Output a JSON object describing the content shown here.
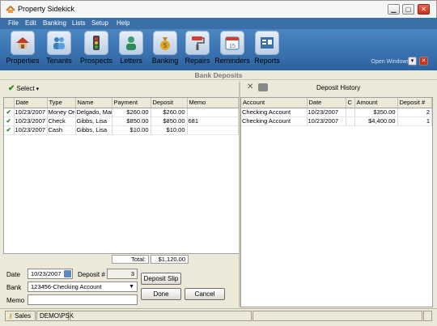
{
  "window": {
    "title": "Property Sidekick",
    "controls": [
      "minimize",
      "maximize",
      "close"
    ]
  },
  "menu": [
    "File",
    "Edit",
    "Banking",
    "Lists",
    "Setup",
    "Help"
  ],
  "toolbar": {
    "items": [
      {
        "label": "Properties",
        "icon": "house-icon"
      },
      {
        "label": "Tenants",
        "icon": "people-icon"
      },
      {
        "label": "Prospects",
        "icon": "traffic-light-icon"
      },
      {
        "label": "Letters",
        "icon": "person-letter-icon"
      },
      {
        "label": "Banking",
        "icon": "money-bag-icon"
      },
      {
        "label": "Repairs",
        "icon": "paint-roller-icon"
      },
      {
        "label": "Reminders",
        "icon": "calendar-icon"
      },
      {
        "label": "Reports",
        "icon": "report-icon"
      }
    ],
    "open_windows": "Open Windows"
  },
  "section_title": "Bank Deposits",
  "deposit_list": {
    "select_label": "Select",
    "columns": [
      "",
      "Date",
      "Type",
      "Name",
      "Payment",
      "Deposit",
      "Memo"
    ],
    "rows": [
      {
        "checked": true,
        "date": "10/23/2007",
        "type": "Money Ord",
        "name": "Delgado, Mar",
        "payment": "$260.00",
        "deposit": "$260.00",
        "memo": ""
      },
      {
        "checked": true,
        "date": "10/23/2007",
        "type": "Check",
        "name": "Gibbs, Lisa",
        "payment": "$850.00",
        "deposit": "$850.00",
        "memo": "681"
      },
      {
        "checked": true,
        "date": "10/23/2007",
        "type": "Cash",
        "name": "Gibbs, Lisa",
        "payment": "$10.00",
        "deposit": "$10.00",
        "memo": ""
      }
    ],
    "total_label": "Total:",
    "total_value": "$1,120.00"
  },
  "form": {
    "date_label": "Date",
    "date_value": "10/23/2007",
    "deposit_no_label": "Deposit #",
    "deposit_no_value": "3",
    "bank_label": "Bank",
    "bank_value": "123456-Checking Account",
    "memo_label": "Memo",
    "memo_value": "",
    "deposit_slip_label": "Deposit Slip",
    "done_label": "Done",
    "cancel_label": "Cancel"
  },
  "history": {
    "title": "Deposit History",
    "columns": [
      "Account",
      "Date",
      "C",
      "Amount",
      "Deposit #"
    ],
    "rows": [
      {
        "account": "Checking Account",
        "date": "10/23/2007",
        "c": "",
        "amount": "$350.00",
        "deposit_no": "2"
      },
      {
        "account": "Checking Account",
        "date": "10/23/2007",
        "c": "",
        "amount": "$4,400.00",
        "deposit_no": "1"
      }
    ]
  },
  "status": {
    "user": "Sales",
    "db": "DEMO\\PSK"
  },
  "colors": {
    "menubar": "#3a6fa8",
    "toolbar": "#2d62a0",
    "check": "#1f8a1f",
    "close": "#c8311c"
  }
}
